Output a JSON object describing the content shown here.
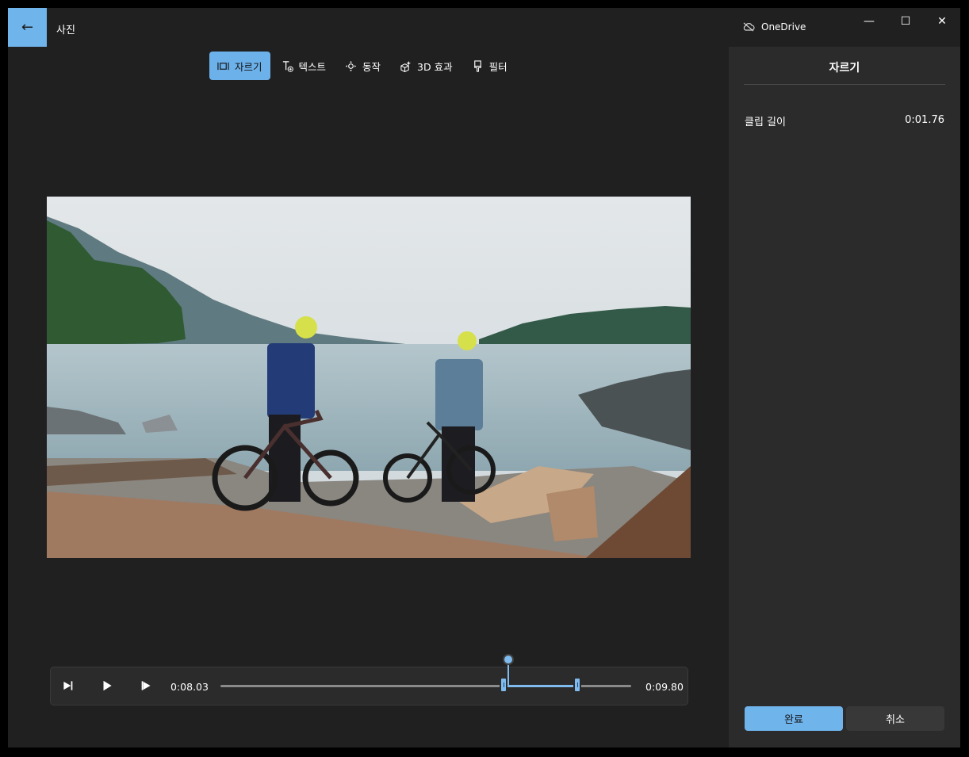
{
  "app": {
    "title": "사진",
    "onedrive_label": "OneDrive"
  },
  "window_controls": {
    "minimize": "—",
    "maximize": "☐",
    "close": "✕"
  },
  "toolbar": {
    "items": [
      {
        "label": "자르기",
        "icon": "trim-icon",
        "active": true
      },
      {
        "label": "텍스트",
        "icon": "text-add-icon",
        "active": false
      },
      {
        "label": "동작",
        "icon": "motion-icon",
        "active": false
      },
      {
        "label": "3D 효과",
        "icon": "3d-effects-icon",
        "active": false
      },
      {
        "label": "필터",
        "icon": "filter-brush-icon",
        "active": false
      }
    ]
  },
  "panel": {
    "title": "자르기",
    "clip_length_label": "클립 길이",
    "clip_length_value": "0:01.76",
    "done_label": "완료",
    "cancel_label": "취소"
  },
  "timeline": {
    "start_time": "0:08.03",
    "end_time": "0:09.80",
    "selection_start_fraction": 0.69,
    "selection_end_fraction": 0.868,
    "playhead_fraction": 0.7
  },
  "colors": {
    "accent": "#70b4ec",
    "background": "#202020",
    "panel": "#2b2b2b"
  }
}
